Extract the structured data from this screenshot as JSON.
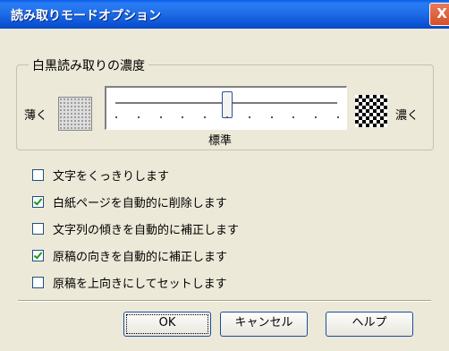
{
  "window": {
    "title": "読み取りモードオプション",
    "close_glyph": "X"
  },
  "density": {
    "group_title": "白黒読み取りの濃度",
    "light_label": "薄く",
    "dark_label": "濃く",
    "standard_label": "標準",
    "slider_value_fraction": 0.5
  },
  "options": [
    {
      "label": "文字をくっきりします",
      "checked": false
    },
    {
      "label": "白紙ページを自動的に削除します",
      "checked": true
    },
    {
      "label": "文字列の傾きを自動的に補正します",
      "checked": false
    },
    {
      "label": "原稿の向きを自動的に補正します",
      "checked": true
    },
    {
      "label": "原稿を上向きにしてセットします",
      "checked": false
    }
  ],
  "buttons": {
    "ok": "OK",
    "cancel": "キャンセル",
    "help": "ヘルプ"
  }
}
